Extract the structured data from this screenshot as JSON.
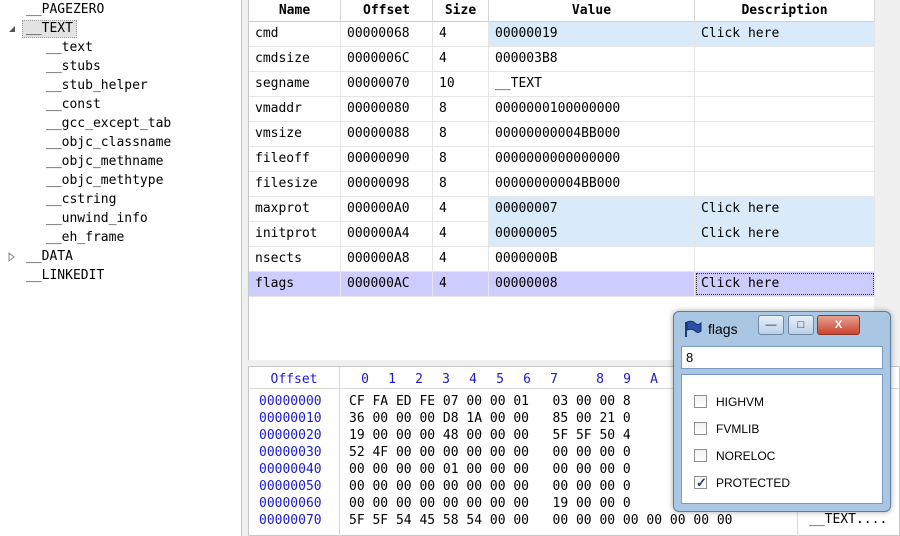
{
  "tree": {
    "items": [
      {
        "label": "__PAGEZERO",
        "level": 0,
        "expander": "none"
      },
      {
        "label": "__TEXT",
        "level": 0,
        "expander": "open",
        "selected": true
      },
      {
        "label": "__text",
        "level": 1,
        "expander": "none"
      },
      {
        "label": "__stubs",
        "level": 1,
        "expander": "none"
      },
      {
        "label": "__stub_helper",
        "level": 1,
        "expander": "none"
      },
      {
        "label": "__const",
        "level": 1,
        "expander": "none"
      },
      {
        "label": "__gcc_except_tab",
        "level": 1,
        "expander": "none"
      },
      {
        "label": "__objc_classname",
        "level": 1,
        "expander": "none"
      },
      {
        "label": "__objc_methname",
        "level": 1,
        "expander": "none"
      },
      {
        "label": "__objc_methtype",
        "level": 1,
        "expander": "none"
      },
      {
        "label": "__cstring",
        "level": 1,
        "expander": "none"
      },
      {
        "label": "__unwind_info",
        "level": 1,
        "expander": "none"
      },
      {
        "label": "__eh_frame",
        "level": 1,
        "expander": "none"
      },
      {
        "label": "__DATA",
        "level": 0,
        "expander": "closed"
      },
      {
        "label": "__LINKEDIT",
        "level": 0,
        "expander": "none"
      }
    ]
  },
  "table": {
    "columns": [
      "Name",
      "Offset",
      "Size",
      "Value",
      "Description"
    ],
    "rows": [
      {
        "name": "cmd",
        "offset": "00000068",
        "size": "4",
        "value": "00000019",
        "description": "Click here",
        "editable": true
      },
      {
        "name": "cmdsize",
        "offset": "0000006C",
        "size": "4",
        "value": "000003B8",
        "description": "",
        "editable": false
      },
      {
        "name": "segname",
        "offset": "00000070",
        "size": "10",
        "value": "__TEXT",
        "description": "",
        "editable": false
      },
      {
        "name": "vmaddr",
        "offset": "00000080",
        "size": "8",
        "value": "0000000100000000",
        "description": "",
        "editable": false
      },
      {
        "name": "vmsize",
        "offset": "00000088",
        "size": "8",
        "value": "00000000004BB000",
        "description": "",
        "editable": false
      },
      {
        "name": "fileoff",
        "offset": "00000090",
        "size": "8",
        "value": "0000000000000000",
        "description": "",
        "editable": false
      },
      {
        "name": "filesize",
        "offset": "00000098",
        "size": "8",
        "value": "00000000004BB000",
        "description": "",
        "editable": false
      },
      {
        "name": "maxprot",
        "offset": "000000A0",
        "size": "4",
        "value": "00000007",
        "description": "Click here",
        "editable": true
      },
      {
        "name": "initprot",
        "offset": "000000A4",
        "size": "4",
        "value": "00000005",
        "description": "Click here",
        "editable": true
      },
      {
        "name": "nsects",
        "offset": "000000A8",
        "size": "4",
        "value": "0000000B",
        "description": "",
        "editable": false
      },
      {
        "name": "flags",
        "offset": "000000AC",
        "size": "4",
        "value": "00000008",
        "description": "Click here",
        "editable": true,
        "selected": true
      }
    ]
  },
  "hex": {
    "header": {
      "offset": "Offset",
      "cols": [
        "0",
        "1",
        "2",
        "3",
        "4",
        "5",
        "6",
        "7",
        "8",
        "9",
        "A"
      ]
    },
    "rows": [
      {
        "offset": "00000000",
        "bytes": "CF FA ED FE 07 00 00 01   03 00 00 8"
      },
      {
        "offset": "00000010",
        "bytes": "36 00 00 00 D8 1A 00 00   85 00 21 0"
      },
      {
        "offset": "00000020",
        "bytes": "19 00 00 00 48 00 00 00   5F 5F 50 4"
      },
      {
        "offset": "00000030",
        "bytes": "52 4F 00 00 00 00 00 00   00 00 00 0"
      },
      {
        "offset": "00000040",
        "bytes": "00 00 00 00 01 00 00 00   00 00 00 0"
      },
      {
        "offset": "00000050",
        "bytes": "00 00 00 00 00 00 00 00   00 00 00 0"
      },
      {
        "offset": "00000060",
        "bytes": "00 00 00 00 00 00 00 00   19 00 00 0"
      },
      {
        "offset": "00000070",
        "bytes": "5F 5F 54 45 58 54 00 00   00 00 00 00 00 00 00 00"
      }
    ],
    "ascii_last": "__TEXT...."
  },
  "popup": {
    "title": "flags",
    "input_value": "8",
    "min_label": "—",
    "max_label": "□",
    "close_label": "X",
    "options": [
      {
        "label": "HIGHVM",
        "checked": false
      },
      {
        "label": "FVMLIB",
        "checked": false
      },
      {
        "label": "NORELOC",
        "checked": false
      },
      {
        "label": "PROTECTED",
        "checked": true
      }
    ]
  }
}
